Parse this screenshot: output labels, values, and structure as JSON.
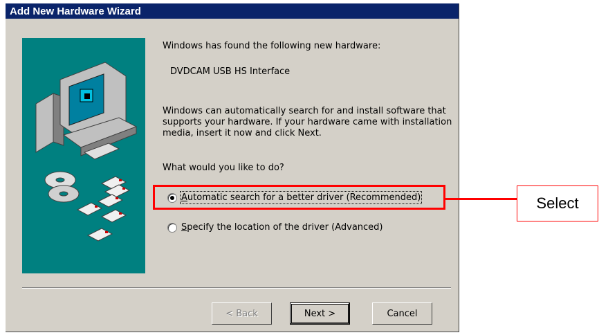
{
  "window": {
    "title": "Add New Hardware Wizard"
  },
  "main": {
    "found_text": "Windows has found the following new hardware:",
    "device_name": "DVDCAM USB HS Interface",
    "description": "Windows can automatically search for and install software that supports your hardware. If your hardware came with installation media, insert it now and click Next.",
    "question": "What would you like to do?",
    "options": [
      {
        "label": "Automatic search for a better driver (Recommended)",
        "mnemonic": "A",
        "selected": true
      },
      {
        "label": "Specify the location of the driver (Advanced)",
        "mnemonic": "S",
        "selected": false
      }
    ]
  },
  "buttons": {
    "back": "< Back",
    "next": "Next >",
    "cancel": "Cancel"
  },
  "annotation": {
    "callout_label": "Select",
    "color": "#ff0000"
  },
  "colors": {
    "titlebar": "#0a246a",
    "dialog_bg": "#d4d0c8",
    "side_image_bg": "#008080"
  }
}
